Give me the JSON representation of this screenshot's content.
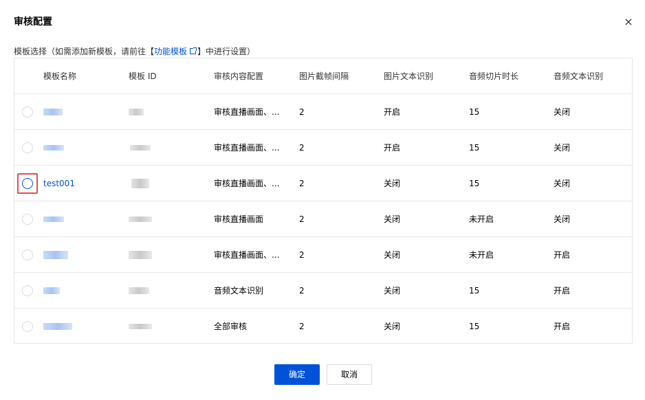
{
  "dialog": {
    "title": "审核配置",
    "close_icon": "×",
    "hint_prefix": "模板选择（如需添加新模板，请前往【",
    "hint_link": "功能模板",
    "hint_suffix": "】中进行设置）"
  },
  "table": {
    "headers": [
      "模板名称",
      "模板 ID",
      "审核内容配置",
      "图片截帧间隔",
      "图片文本识别",
      "音频切片时长",
      "音频文本识别"
    ],
    "rows": [
      {
        "name": "",
        "content": "审核直播画面、...",
        "interval": "2",
        "ocr": "开启",
        "audio": "15",
        "asr": "关闭"
      },
      {
        "name": "",
        "content": "审核直播画面、...",
        "interval": "2",
        "ocr": "开启",
        "audio": "15",
        "asr": "关闭"
      },
      {
        "name": "test001",
        "content": "审核直播画面、...",
        "interval": "2",
        "ocr": "关闭",
        "audio": "15",
        "asr": "关闭"
      },
      {
        "name": "",
        "content": "审核直播画面",
        "interval": "2",
        "ocr": "关闭",
        "audio": "未开启",
        "asr": "关闭"
      },
      {
        "name": "",
        "content": "审核直播画面、...",
        "interval": "2",
        "ocr": "关闭",
        "audio": "未开启",
        "asr": "开启"
      },
      {
        "name": "",
        "content": "音频文本识别",
        "interval": "2",
        "ocr": "关闭",
        "audio": "15",
        "asr": "开启"
      },
      {
        "name": "",
        "content": "全部审核",
        "interval": "2",
        "ocr": "关闭",
        "audio": "15",
        "asr": "开启"
      }
    ]
  },
  "footer": {
    "ok_label": "确定",
    "cancel_label": "取消"
  },
  "colors": {
    "primary": "#0052d9",
    "highlight": "#e34d59",
    "border": "#e7e7e7"
  }
}
